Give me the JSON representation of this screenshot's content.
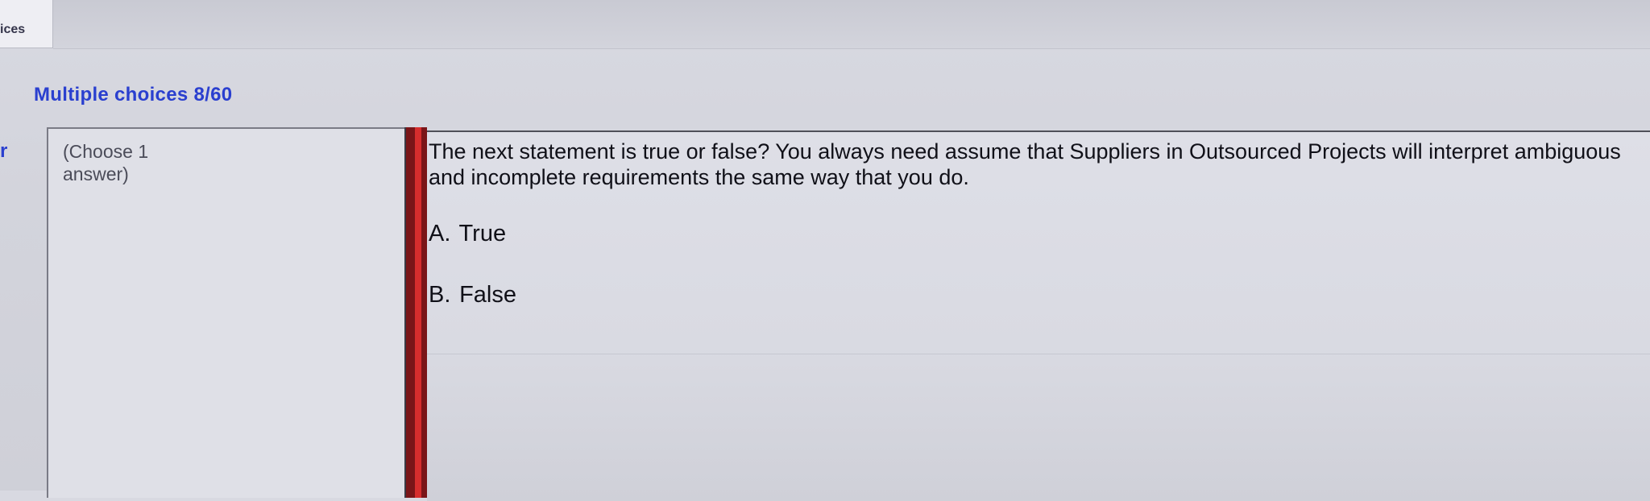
{
  "top_tab": {
    "label": "ices"
  },
  "section": {
    "title": "Multiple choices 8/60",
    "left_marker": "r"
  },
  "instruction": {
    "text": "(Choose 1 answer)"
  },
  "question": {
    "text": "The next statement is true or false? You always need assume that Suppliers in Outsourced Projects will interpret ambiguous and incomplete requirements the same way that you do."
  },
  "options": [
    {
      "letter": "A.",
      "text": "True"
    },
    {
      "letter": "B.",
      "text": "False"
    }
  ],
  "colors": {
    "title": "#2a3fcf",
    "divider": "#d62d2d",
    "text": "#101018"
  }
}
